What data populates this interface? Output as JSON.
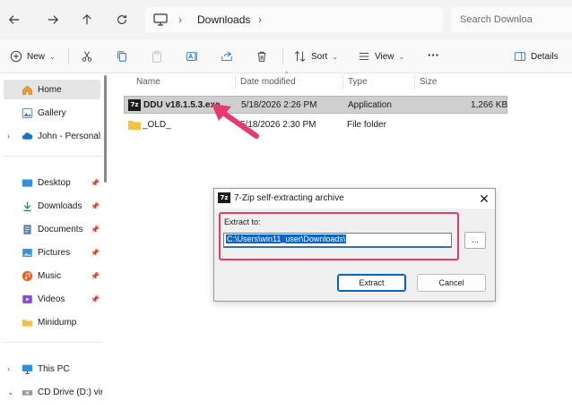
{
  "address": {
    "crumb": "Downloads",
    "search_placeholder": "Search Downloa"
  },
  "toolbar": {
    "new_label": "New",
    "sort_label": "Sort",
    "view_label": "View",
    "more_label": "···",
    "details_label": "Details"
  },
  "sidebar": {
    "items": [
      {
        "label": "Home"
      },
      {
        "label": "Gallery"
      },
      {
        "label": "John - Personal"
      },
      {
        "label": "Desktop"
      },
      {
        "label": "Downloads"
      },
      {
        "label": "Documents"
      },
      {
        "label": "Pictures"
      },
      {
        "label": "Music"
      },
      {
        "label": "Videos"
      },
      {
        "label": "Minidump"
      },
      {
        "label": "This PC"
      },
      {
        "label": "CD Drive (D:) vir"
      }
    ]
  },
  "files": {
    "columns": [
      "Name",
      "Date modified",
      "Type",
      "Size"
    ],
    "rows": [
      {
        "name": "DDU v18.1.5.3.exe",
        "date": "5/18/2026 2:26 PM",
        "type": "Application",
        "size": "1,266 KB"
      },
      {
        "name": "_OLD_",
        "date": "5/18/2026 2:30 PM",
        "type": "File folder",
        "size": ""
      }
    ]
  },
  "dialog": {
    "icon_text": "7z",
    "title": "7-Zip self-extracting archive",
    "extract_label": "Extract to:",
    "path_value": "C:\\Users\\win11_user\\Downloads\\",
    "browse_label": "...",
    "extract_button": "Extract",
    "cancel_button": "Cancel",
    "close_glyph": "✕"
  },
  "colors": {
    "annotation": "#e8396b",
    "selection": "#0a64c8",
    "folder": "#f4c242"
  }
}
